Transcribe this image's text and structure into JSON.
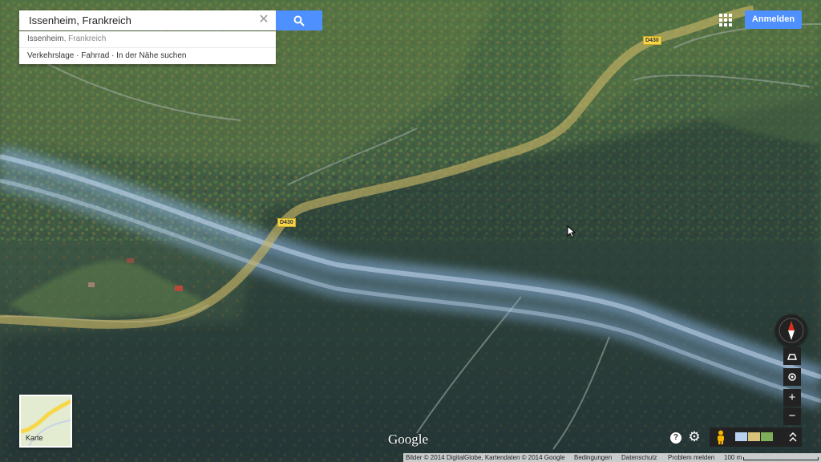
{
  "search": {
    "value": "Issenheim, Frankreich",
    "clear_icon": "close-icon",
    "button_icon": "search-icon"
  },
  "suggestions": {
    "place_bold": "Issenheim",
    "place_rest": ", Frankreich",
    "links": "Verkehrslage · Fahrrad · In der Nähe suchen"
  },
  "header": {
    "apps_icon": "apps-grid-icon",
    "signin_label": "Anmelden"
  },
  "map": {
    "road_labels": [
      "D430",
      "D430"
    ],
    "road_color": "#b8a55a",
    "river_color": "#8fb8e6"
  },
  "controls": {
    "compass_icon": "compass-icon",
    "tilt_icon": "tilt-icon",
    "location_icon": "my-location-icon",
    "zoom_in": "+",
    "zoom_out": "−",
    "pegman_icon": "pegman-icon",
    "expand_icon": "chevron-up-icon",
    "help_icon": "?",
    "settings_icon": "⚙"
  },
  "minimap": {
    "label": "Karte"
  },
  "logo": "Google",
  "footer": {
    "attribution": "Bilder © 2014 DigitalGlobe, Kartendaten © 2014 Google",
    "terms": "Bedingungen",
    "privacy": "Datenschutz",
    "report": "Problem melden",
    "scale": "100 m"
  }
}
